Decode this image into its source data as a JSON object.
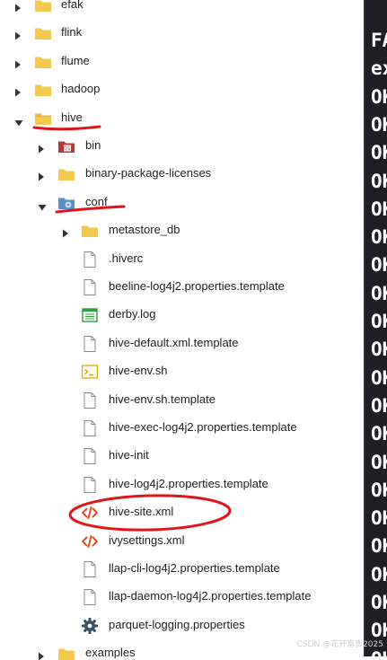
{
  "tree": [
    {
      "label": "efak",
      "depth": 0,
      "arrow": "right",
      "icon": "folder-icon"
    },
    {
      "label": "flink",
      "depth": 0,
      "arrow": "right",
      "icon": "folder-icon"
    },
    {
      "label": "flume",
      "depth": 0,
      "arrow": "right",
      "icon": "folder-icon"
    },
    {
      "label": "hadoop",
      "depth": 0,
      "arrow": "right",
      "icon": "folder-icon"
    },
    {
      "label": "hive",
      "depth": 0,
      "arrow": "down",
      "icon": "folder-open-icon"
    },
    {
      "label": "bin",
      "depth": 1,
      "arrow": "right",
      "icon": "bin-folder-icon"
    },
    {
      "label": "binary-package-licenses",
      "depth": 1,
      "arrow": "right",
      "icon": "folder-icon"
    },
    {
      "label": "conf",
      "depth": 1,
      "arrow": "down",
      "icon": "config-folder-icon"
    },
    {
      "label": "metastore_db",
      "depth": 2,
      "arrow": "right",
      "icon": "folder-icon"
    },
    {
      "label": ".hiverc",
      "depth": 2,
      "arrow": "none",
      "icon": "file-icon"
    },
    {
      "label": "beeline-log4j2.properties.template",
      "depth": 2,
      "arrow": "none",
      "icon": "file-icon"
    },
    {
      "label": "derby.log",
      "depth": 2,
      "arrow": "none",
      "icon": "log-file-icon"
    },
    {
      "label": "hive-default.xml.template",
      "depth": 2,
      "arrow": "none",
      "icon": "file-icon"
    },
    {
      "label": "hive-env.sh",
      "depth": 2,
      "arrow": "none",
      "icon": "shell-script-icon"
    },
    {
      "label": "hive-env.sh.template",
      "depth": 2,
      "arrow": "none",
      "icon": "file-icon"
    },
    {
      "label": "hive-exec-log4j2.properties.template",
      "depth": 2,
      "arrow": "none",
      "icon": "file-icon"
    },
    {
      "label": "hive-init",
      "depth": 2,
      "arrow": "none",
      "icon": "file-icon"
    },
    {
      "label": "hive-log4j2.properties.template",
      "depth": 2,
      "arrow": "none",
      "icon": "file-icon"
    },
    {
      "label": "hive-site.xml",
      "depth": 2,
      "arrow": "none",
      "icon": "xml-file-icon"
    },
    {
      "label": "ivysettings.xml",
      "depth": 2,
      "arrow": "none",
      "icon": "xml-file-icon"
    },
    {
      "label": "llap-cli-log4j2.properties.template",
      "depth": 2,
      "arrow": "none",
      "icon": "file-icon"
    },
    {
      "label": "llap-daemon-log4j2.properties.template",
      "depth": 2,
      "arrow": "none",
      "icon": "file-icon"
    },
    {
      "label": "parquet-logging.properties",
      "depth": 2,
      "arrow": "none",
      "icon": "gear-icon"
    },
    {
      "label": "examples",
      "depth": 1,
      "arrow": "right",
      "icon": "folder-icon"
    }
  ],
  "terminal": {
    "lines": [
      "FA",
      "ex",
      "OK",
      "OK",
      "OK",
      "OK",
      "OK",
      "OK",
      "OK",
      "OK",
      "OK",
      "OK",
      "OK",
      "OK",
      "OK",
      "OK",
      "OK",
      "OK",
      "OK",
      "OK",
      "OK",
      "OK",
      "OK"
    ]
  },
  "watermark": "CSDN @花开富贵2025",
  "colors": {
    "folder": "#f2c94c",
    "annotation_red": "#e0151b",
    "terminal_bg": "#1e1f22",
    "xml_icon": "#e44d26",
    "log_icon": "#2e9e3e",
    "bin_icon": "#b33a3a",
    "config_icon": "#5b8fc7"
  }
}
